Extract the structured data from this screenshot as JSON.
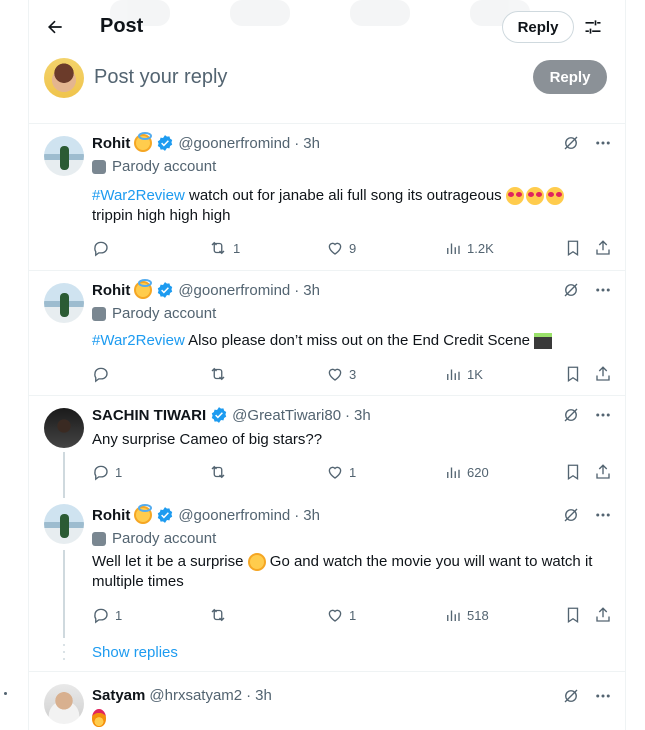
{
  "header": {
    "title": "Post",
    "reply_button": "Reply"
  },
  "composer": {
    "placeholder": "Post your reply",
    "reply_button": "Reply"
  },
  "tweets": [
    {
      "name": "Rohit",
      "handle": "@goonerfromind",
      "dot": "·",
      "time": "3h",
      "parody": "Parody account",
      "hashtag": "#War2Review",
      "text": " watch out for janabe ali full song its outrageous ",
      "text2": "trippin high high high",
      "replies": "",
      "reposts": "1",
      "likes": "9",
      "views": "1.2K"
    },
    {
      "name": "Rohit",
      "handle": "@goonerfromind",
      "dot": "·",
      "time": "3h",
      "parody": "Parody account",
      "hashtag": "#War2Review",
      "text": " Also please don’t miss out on the End Credit Scene ",
      "replies": "",
      "reposts": "",
      "likes": "3",
      "views": "1K"
    },
    {
      "name": "SACHIN TIWARI",
      "handle": "@GreatTiwari80",
      "dot": "·",
      "time": "3h",
      "text": "Any surprise Cameo of big stars??",
      "replies": "1",
      "reposts": "",
      "likes": "1",
      "views": "620"
    },
    {
      "name": "Rohit",
      "handle": "@goonerfromind",
      "dot": "·",
      "time": "3h",
      "parody": "Parody account",
      "text": "Well let it be a surprise ",
      "text_after": " Go and watch the movie you will want to watch it",
      "text2": "multiple times",
      "replies": "1",
      "reposts": "",
      "likes": "1",
      "views": "518"
    },
    {
      "name": "Satyam",
      "handle": "@hrxsatyam2",
      "dot": "·",
      "time": "3h"
    }
  ],
  "show_replies": "Show replies",
  "colors": {
    "link": "#1d9bf0",
    "muted": "#536471",
    "verified": "#1d9bf0",
    "disabled_button": "#8b9197"
  }
}
